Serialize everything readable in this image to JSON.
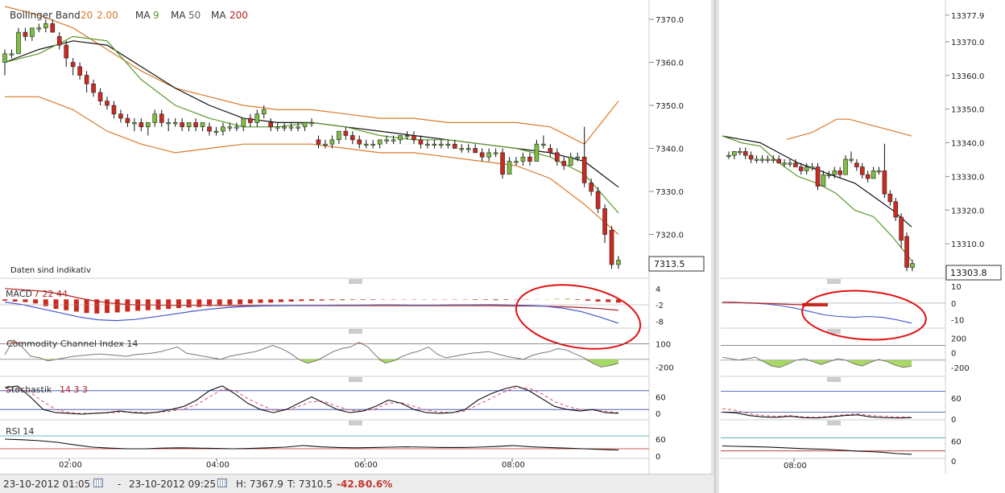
{
  "left_chart": {
    "legend": {
      "bollinger": {
        "label": "Bollinger Band",
        "period": "20",
        "mult": "2.00"
      },
      "ma_short": {
        "label": "MA",
        "period": "9"
      },
      "ma_mid": {
        "label": "MA",
        "period": "50"
      },
      "ma_long": {
        "label": "MA",
        "period": "200"
      }
    },
    "note": "Daten sind indikativ",
    "price_label": "7313.5",
    "price_ticks": [
      "7370.0",
      "7360.0",
      "7350.0",
      "7340.0",
      "7330.0",
      "7320.0"
    ],
    "time_ticks": [
      "02:00",
      "04:00",
      "06:00",
      "08:00"
    ],
    "macd": {
      "label": "MACD",
      "p1": "7",
      "p2": "22",
      "p3": "44",
      "ticks": [
        "4",
        "-2",
        "-8"
      ]
    },
    "cci": {
      "label": "Commodity Channel Index",
      "period": "14",
      "ticks": [
        "100",
        "-200"
      ]
    },
    "stoch": {
      "label": "Stochastik",
      "p1": "14",
      "p2": "3",
      "p3": "3",
      "ticks": [
        "60",
        "0"
      ]
    },
    "rsi": {
      "label": "RSI",
      "period": "14",
      "ticks": [
        "60",
        "0"
      ]
    }
  },
  "right_chart": {
    "price_label": "13303.8",
    "price_ticks": [
      "13377.9",
      "13370.0",
      "13360.0",
      "13350.0",
      "13340.0",
      "13330.0",
      "13320.0",
      "13310.0"
    ],
    "time_ticks": [
      "08:00"
    ],
    "macd_ticks": [
      "10",
      "0",
      "-10"
    ],
    "cci_ticks": [
      "200",
      "0",
      "-200"
    ],
    "stoch_ticks": [
      "60",
      "0"
    ],
    "rsi_ticks": [
      "60",
      "0"
    ]
  },
  "footer": {
    "from": "23-10-2012 01:05",
    "separator": "-",
    "to": "23-10-2012 09:25",
    "high": "H: 7367.9",
    "low": "T: 7310.5",
    "change": "-42.8",
    "change_pct": "-0.6%"
  },
  "colors": {
    "up": "#7fbf3f",
    "down": "#cc2a1f",
    "bollinger": "#d97a2a",
    "ma9": "#5a9a2a",
    "ma50": "#111111",
    "ma200": "#b22222",
    "macd_line": "#4455cc",
    "cci_fill": "#9ad24a",
    "stoch_signal": "#e05060",
    "annotation": "#e01010"
  },
  "chart_data": [
    {
      "type": "line",
      "title": "Bollinger Band 20 2.00 / MA 9 / MA 50 / MA 200",
      "ylim": [
        7310,
        7373
      ],
      "candles": [
        [
          7360,
          7363,
          7357,
          7362
        ],
        [
          7362,
          7363,
          7361,
          7362
        ],
        [
          7362,
          7368,
          7362,
          7367
        ],
        [
          7367,
          7368,
          7365,
          7366
        ],
        [
          7366,
          7368,
          7365,
          7368
        ],
        [
          7368,
          7369,
          7367,
          7368
        ],
        [
          7368,
          7370,
          7367,
          7369
        ],
        [
          7369,
          7370,
          7367,
          7367
        ],
        [
          7366,
          7367,
          7363,
          7364
        ],
        [
          7364,
          7365,
          7359,
          7361
        ],
        [
          7360,
          7361,
          7357,
          7359
        ],
        [
          7359,
          7360,
          7356,
          7357
        ],
        [
          7357,
          7358,
          7353,
          7355
        ],
        [
          7355,
          7356,
          7352,
          7353
        ],
        [
          7353,
          7354,
          7350,
          7351
        ],
        [
          7351,
          7352,
          7349,
          7350
        ],
        [
          7350,
          7351,
          7347,
          7348
        ],
        [
          7348,
          7349,
          7346,
          7347
        ],
        [
          7347,
          7348,
          7345,
          7346
        ],
        [
          7346,
          7347,
          7344,
          7346
        ],
        [
          7346,
          7347,
          7344,
          7345
        ],
        [
          7345,
          7346,
          7343,
          7346
        ],
        [
          7346,
          7349,
          7345,
          7348
        ],
        [
          7348,
          7349,
          7345,
          7346
        ],
        [
          7346,
          7347,
          7344,
          7346
        ],
        [
          7346,
          7347,
          7345,
          7346
        ],
        [
          7346,
          7347,
          7344,
          7345
        ],
        [
          7345,
          7346,
          7344,
          7346
        ],
        [
          7346,
          7347,
          7344,
          7345
        ],
        [
          7345,
          7346,
          7344,
          7346
        ],
        [
          7345,
          7346,
          7343,
          7344
        ],
        [
          7344,
          7345,
          7343,
          7344
        ],
        [
          7344,
          7346,
          7343,
          7345
        ],
        [
          7345,
          7346,
          7344,
          7345
        ],
        [
          7345,
          7346,
          7344,
          7345
        ],
        [
          7345,
          7347,
          7344,
          7347
        ],
        [
          7347,
          7348,
          7345,
          7346
        ],
        [
          7346,
          7349,
          7345,
          7348
        ],
        [
          7348,
          7350,
          7347,
          7349
        ],
        [
          7346,
          7347,
          7344,
          7345
        ],
        [
          7345,
          7346,
          7344,
          7345
        ],
        [
          7345,
          7346,
          7344,
          7345
        ],
        [
          7345,
          7346,
          7344,
          7345
        ],
        [
          7345,
          7346,
          7344,
          7345
        ],
        [
          7345,
          7346,
          7344,
          7346
        ],
        [
          7346,
          7347,
          7345,
          7346
        ],
        [
          7342,
          7343,
          7340,
          7341
        ],
        [
          7341,
          7342,
          7340,
          7341
        ],
        [
          7341,
          7343,
          7340,
          7342
        ],
        [
          7342,
          7344,
          7341,
          7344
        ],
        [
          7344,
          7345,
          7342,
          7343
        ],
        [
          7343,
          7344,
          7341,
          7342
        ],
        [
          7342,
          7343,
          7340,
          7341
        ],
        [
          7341,
          7342,
          7340,
          7341
        ],
        [
          7341,
          7342,
          7340,
          7341
        ],
        [
          7341,
          7342,
          7340,
          7342
        ],
        [
          7342,
          7343,
          7341,
          7342
        ],
        [
          7342,
          7343,
          7341,
          7342
        ],
        [
          7342,
          7343,
          7341,
          7343
        ],
        [
          7343,
          7344,
          7342,
          7343
        ],
        [
          7343,
          7344,
          7341,
          7342
        ],
        [
          7342,
          7343,
          7340,
          7341
        ],
        [
          7341,
          7342,
          7340,
          7341
        ],
        [
          7341,
          7342,
          7340,
          7341
        ],
        [
          7341,
          7342,
          7340,
          7341
        ],
        [
          7341,
          7342,
          7340,
          7341
        ],
        [
          7341,
          7342,
          7340,
          7340
        ],
        [
          7340,
          7341,
          7339,
          7340
        ],
        [
          7340,
          7341,
          7339,
          7340
        ],
        [
          7340,
          7341,
          7339,
          7339
        ],
        [
          7339,
          7340,
          7337,
          7338
        ],
        [
          7338,
          7340,
          7337,
          7339
        ],
        [
          7339,
          7340,
          7338,
          7339
        ],
        [
          7339,
          7340,
          7333,
          7334
        ],
        [
          7334,
          7338,
          7334,
          7337
        ],
        [
          7337,
          7338,
          7336,
          7337
        ],
        [
          7337,
          7339,
          7336,
          7338
        ],
        [
          7338,
          7339,
          7336,
          7337
        ],
        [
          7337,
          7342,
          7337,
          7341
        ],
        [
          7341,
          7343,
          7340,
          7341
        ],
        [
          7340,
          7341,
          7338,
          7339
        ],
        [
          7339,
          7340,
          7336,
          7337
        ],
        [
          7337,
          7338,
          7335,
          7336
        ],
        [
          7336,
          7339,
          7336,
          7338
        ],
        [
          7338,
          7339,
          7337,
          7338
        ],
        [
          7338,
          7345,
          7331,
          7332
        ],
        [
          7332,
          7333,
          7329,
          7330
        ],
        [
          7330,
          7331,
          7325,
          7326
        ],
        [
          7326,
          7327,
          7318,
          7320
        ],
        [
          7321,
          7322,
          7312,
          7313
        ],
        [
          7313,
          7315,
          7312,
          7314
        ]
      ],
      "bollinger_upper": [
        7373,
        7371,
        7368,
        7363,
        7358,
        7354,
        7352,
        7350,
        7349,
        7349,
        7348,
        7347,
        7347,
        7346,
        7346,
        7346,
        7345,
        7341,
        7351
      ],
      "bollinger_lower": [
        7352,
        7352,
        7349,
        7344,
        7341,
        7339,
        7340,
        7341,
        7341,
        7341,
        7340,
        7339,
        7339,
        7338,
        7337,
        7336,
        7333,
        7327,
        7320
      ],
      "ma9": [
        7360,
        7362,
        7366,
        7365,
        7356,
        7350,
        7347,
        7345,
        7345,
        7346,
        7345,
        7343,
        7342,
        7342,
        7341,
        7340,
        7338,
        7334,
        7325
      ],
      "ma50": [
        7360,
        7363,
        7365,
        7364,
        7359,
        7354,
        7350,
        7347,
        7346,
        7346,
        7345,
        7344,
        7343,
        7342,
        7341,
        7340,
        7339,
        7337,
        7331
      ],
      "ma200": [
        7360,
        7363,
        7365,
        7364,
        7359,
        7354,
        7350,
        7347,
        7346,
        7346,
        7345,
        7344,
        7343,
        7342,
        7341,
        7340,
        7339,
        7337,
        7331
      ]
    },
    {
      "type": "bar",
      "title": "MACD 7 22 44",
      "ylim": [
        -10,
        6
      ],
      "histogram": [
        -0.5,
        -0.8,
        -1.0,
        -1.5,
        -2.5,
        -3.5,
        -4.0,
        -4.5,
        -5.0,
        -5.2,
        -5.0,
        -4.8,
        -4.5,
        -4.2,
        -4.0,
        -3.8,
        -3.5,
        -3.2,
        -3.0,
        -2.8,
        -2.5,
        -2.3,
        -2.0,
        -1.8,
        -1.5,
        -1.3,
        -1.2,
        -1.0,
        -0.8,
        -0.6,
        -0.5,
        -0.4,
        -0.3,
        -0.3,
        -0.2,
        -0.2,
        -0.2,
        -0.1,
        -0.1,
        -0.1,
        -0.1,
        -0.1,
        -0.1,
        -0.1,
        -0.1,
        -0.1,
        -0.2,
        -0.2,
        -0.3,
        -0.2,
        -0.1,
        -0.1,
        0.1,
        0.1,
        0.2,
        0.3,
        -0.2,
        -0.5,
        -0.8,
        -1.0,
        -1.2
      ],
      "macd": [
        -1,
        -2,
        -3.5,
        -5,
        -6.5,
        -7.5,
        -7.8,
        -7.4,
        -6.5,
        -5.5,
        -4.5,
        -3.6,
        -3.0,
        -2.6,
        -2.4,
        -2.3,
        -2.2,
        -2.2,
        -2.1,
        -2.1,
        -2.0,
        -2.0,
        -2.1,
        -2.1,
        -2.0,
        -2.0,
        -1.9,
        -2.0,
        -2.2,
        -2.5,
        -3.2,
        -4.5,
        -6.5,
        -8.8
      ],
      "signal": [
        4,
        3.5,
        3,
        2,
        0.5,
        -0.8,
        -1.6,
        -2.0,
        -2.1,
        -2.2,
        -2.2,
        -2.2,
        -2.3,
        -2.3,
        -2.3,
        -2.3,
        -2.3,
        -2.3,
        -2.3,
        -2.3,
        -2.3,
        -2.3,
        -2.3,
        -2.3,
        -2.3,
        -2.3,
        -2.3,
        -2.4,
        -2.4,
        -2.5,
        -2.7,
        -3.0,
        -3.4,
        -4.0
      ]
    },
    {
      "type": "line",
      "title": "Commodity Channel Index 14",
      "ylim": [
        -300,
        200
      ],
      "values": [
        -40,
        150,
        60,
        -60,
        -80,
        -120,
        -100,
        -80,
        -60,
        -50,
        -40,
        -30,
        -40,
        -50,
        -60,
        -40,
        -30,
        -20,
        0,
        30,
        60,
        -20,
        -40,
        -60,
        -80,
        -100,
        -60,
        -40,
        -20,
        0,
        40,
        80,
        40,
        -20,
        -100,
        -150,
        -120,
        -60,
        0,
        40,
        60,
        120,
        60,
        -60,
        -150,
        -120,
        -60,
        -20,
        10,
        60,
        -30,
        -80,
        -60,
        -40,
        -20,
        -10,
        0,
        -30,
        -60,
        -80,
        -100,
        -50,
        -20,
        0,
        40,
        20,
        -30,
        -80,
        -150,
        -200,
        -180,
        -150
      ],
      "ticks": [
        "100",
        "-200"
      ]
    },
    {
      "type": "line",
      "title": "Stochastik 14 3 3",
      "ylim": [
        0,
        100
      ],
      "k": [
        90,
        95,
        60,
        20,
        10,
        8,
        5,
        8,
        10,
        15,
        10,
        8,
        12,
        20,
        30,
        50,
        80,
        95,
        70,
        40,
        20,
        10,
        20,
        40,
        60,
        40,
        20,
        10,
        15,
        30,
        50,
        40,
        20,
        10,
        8,
        10,
        20,
        50,
        70,
        85,
        95,
        80,
        55,
        30,
        20,
        15,
        20,
        10,
        8
      ],
      "d": [
        80,
        85,
        75,
        45,
        20,
        10,
        8,
        8,
        9,
        12,
        12,
        10,
        11,
        15,
        22,
        35,
        60,
        85,
        80,
        55,
        35,
        18,
        18,
        30,
        45,
        45,
        30,
        18,
        15,
        22,
        40,
        42,
        30,
        18,
        12,
        10,
        15,
        35,
        55,
        75,
        90,
        88,
        70,
        45,
        30,
        20,
        18,
        14,
        10
      ],
      "ticks": [
        "60",
        "0"
      ]
    },
    {
      "type": "line",
      "title": "RSI 14",
      "ylim": [
        0,
        100
      ],
      "values": [
        60,
        58,
        55,
        50,
        42,
        35,
        32,
        30,
        30,
        32,
        33,
        32,
        31,
        30,
        31,
        33,
        35,
        40,
        36,
        34,
        33,
        34,
        35,
        36,
        35,
        34,
        34,
        35,
        37,
        40,
        36,
        34,
        32,
        30,
        28,
        26
      ],
      "ticks": [
        "60",
        "0"
      ]
    }
  ]
}
